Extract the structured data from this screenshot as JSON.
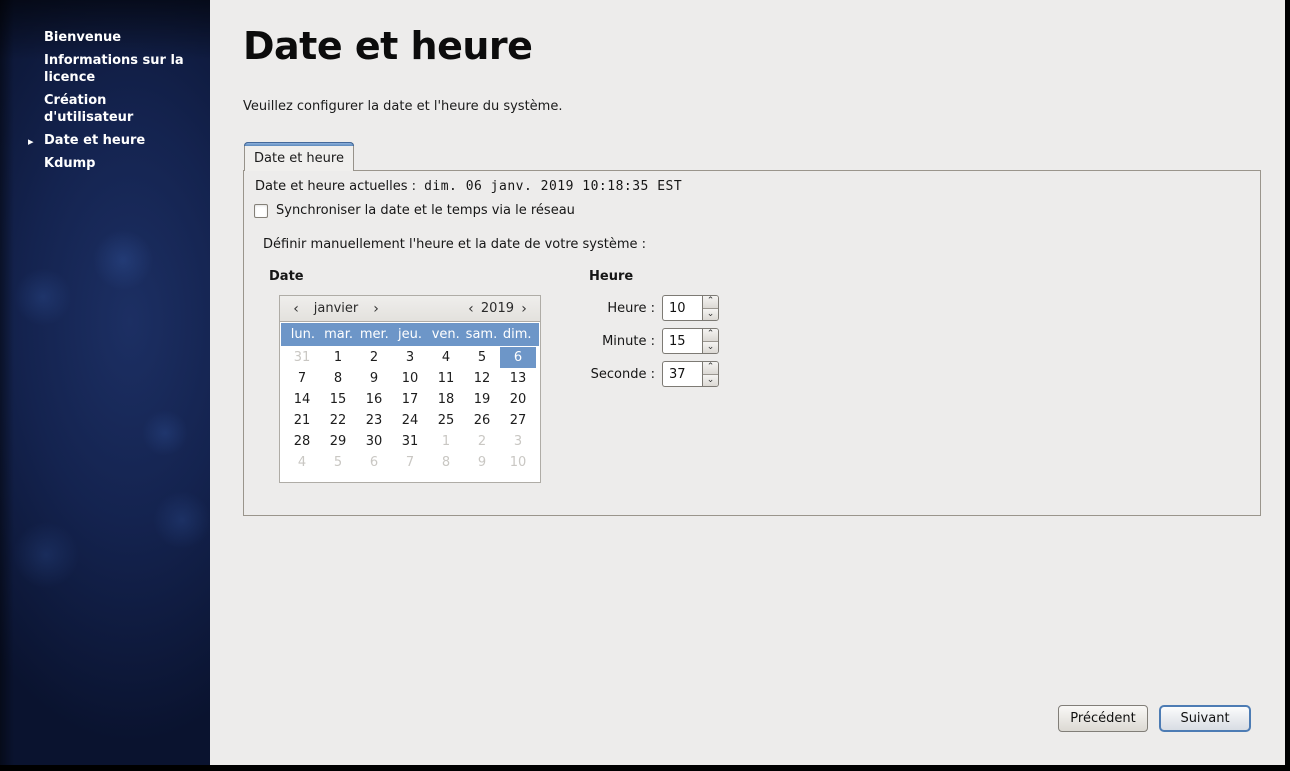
{
  "colors": {
    "accent_blue": "#6d96c8",
    "sidebar_navy": "#14234f",
    "main_bg": "#edeceb",
    "tab_accent": "#5d8abd",
    "next_button_border": "#4d7cb4"
  },
  "icons": {
    "active_marker": "▸",
    "prev_arrow": "‹",
    "next_arrow": "›",
    "spin_up": "⌃",
    "spin_down": "⌄"
  },
  "sidebar": {
    "items": [
      {
        "label": "Bienvenue"
      },
      {
        "label": "Informations sur la licence"
      },
      {
        "label": "Création d'utilisateur"
      },
      {
        "label": "Date et heure",
        "active": true
      },
      {
        "label": "Kdump"
      }
    ]
  },
  "header": {
    "title": "Date et heure",
    "subtitle": "Veuillez configurer la date et l'heure du système."
  },
  "tab": {
    "label": "Date et heure"
  },
  "panel": {
    "current_datetime_label": "Date et heure actuelles :",
    "current_datetime_value": "dim. 06 janv. 2019 10:18:35 EST",
    "sync_checkbox_label": "Synchroniser la date et le temps via le réseau",
    "sync_checked": false,
    "manual_label": "Définir manuellement l'heure et la date de votre système :",
    "date_section_label": "Date",
    "time_section_label": "Heure"
  },
  "calendar": {
    "month": "janvier",
    "year": "2019",
    "selected_day": "6",
    "day_names": [
      "lun.",
      "mar.",
      "mer.",
      "jeu.",
      "ven.",
      "sam.",
      "dim."
    ],
    "weeks": [
      [
        "31",
        "1",
        "2",
        "3",
        "4",
        "5",
        "6"
      ],
      [
        "7",
        "8",
        "9",
        "10",
        "11",
        "12",
        "13"
      ],
      [
        "14",
        "15",
        "16",
        "17",
        "18",
        "19",
        "20"
      ],
      [
        "21",
        "22",
        "23",
        "24",
        "25",
        "26",
        "27"
      ],
      [
        "28",
        "29",
        "30",
        "31",
        "1",
        "2",
        "3"
      ],
      [
        "4",
        "5",
        "6",
        "7",
        "8",
        "9",
        "10"
      ]
    ]
  },
  "time": {
    "fields": [
      {
        "label": "Heure :",
        "value": "10"
      },
      {
        "label": "Minute :",
        "value": "15"
      },
      {
        "label": "Seconde :",
        "value": "37"
      }
    ]
  },
  "footer": {
    "back_label": "Précédent",
    "next_label": "Suivant"
  }
}
